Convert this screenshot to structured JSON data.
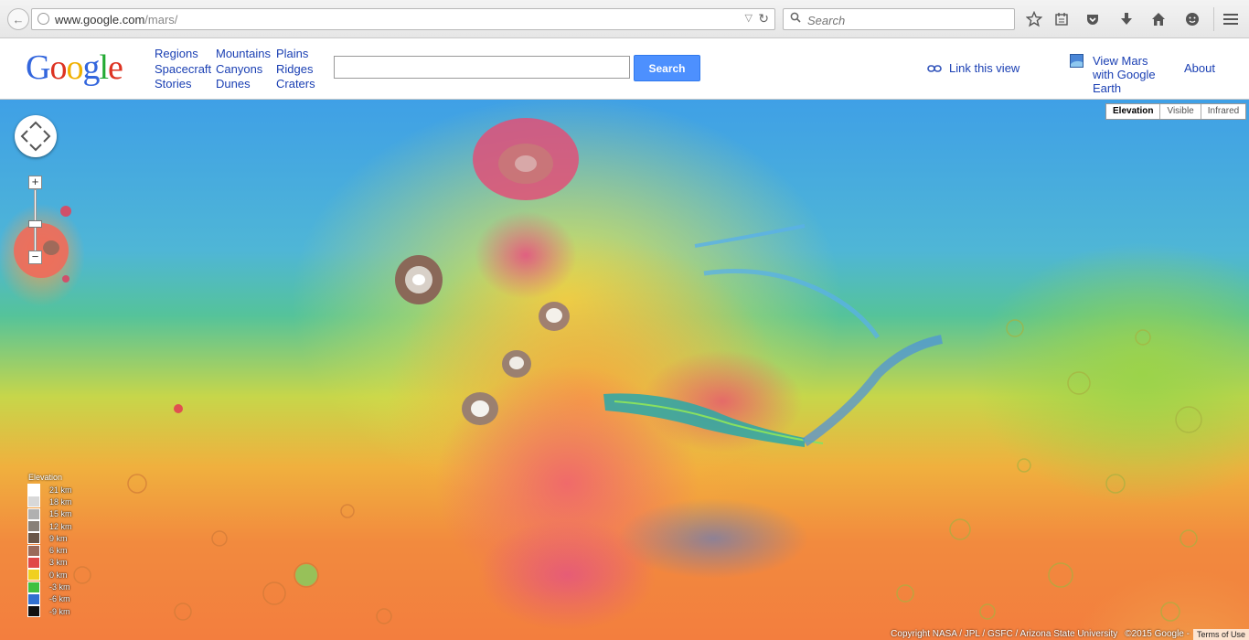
{
  "browser": {
    "url_host": "www.google.com",
    "url_path": "/mars/",
    "search_placeholder": "Search",
    "icons": [
      "back-icon",
      "globe-icon",
      "dropdown-icon",
      "reload-icon",
      "search-icon",
      "star-icon",
      "reading-list-icon",
      "pocket-icon",
      "download-icon",
      "home-icon",
      "chat-icon",
      "menu-icon"
    ]
  },
  "header": {
    "logo": [
      "G",
      "o",
      "o",
      "g",
      "l",
      "e"
    ],
    "logo_colors": [
      "#3366dd",
      "#dd3322",
      "#f0b000",
      "#3366dd",
      "#22aa33",
      "#dd3322"
    ],
    "nav": [
      [
        "Regions",
        "Spacecraft",
        "Stories"
      ],
      [
        "Mountains",
        "Canyons",
        "Dunes"
      ],
      [
        "Plains",
        "Ridges",
        "Craters"
      ]
    ],
    "search_button": "Search",
    "link_view": "Link this view",
    "view_earth": "View Mars with Google Earth",
    "about": "About"
  },
  "map": {
    "layers": [
      "Elevation",
      "Visible",
      "Infrared"
    ],
    "active_layer": "Elevation",
    "legend_title": "Elevation",
    "legend": [
      {
        "label": "21 km",
        "color": "#ffffff"
      },
      {
        "label": "18 km",
        "color": "#d8d8d8"
      },
      {
        "label": "15 km",
        "color": "#b0b0b0"
      },
      {
        "label": "12 km",
        "color": "#888078"
      },
      {
        "label": "9 km",
        "color": "#6a5648"
      },
      {
        "label": "6 km",
        "color": "#9a6a5a"
      },
      {
        "label": "3 km",
        "color": "#e04848"
      },
      {
        "label": "0 km",
        "color": "#f0d020"
      },
      {
        "label": "-3 km",
        "color": "#40c040"
      },
      {
        "label": "-6 km",
        "color": "#3070d0"
      },
      {
        "label": "-9 km",
        "color": "#101010"
      }
    ],
    "copyright": "Copyright NASA / JPL / GSFC / Arizona State University",
    "google_credit": "©2015 Google -",
    "terms": "Terms of Use",
    "zoom_in": "+",
    "zoom_out": "−"
  }
}
